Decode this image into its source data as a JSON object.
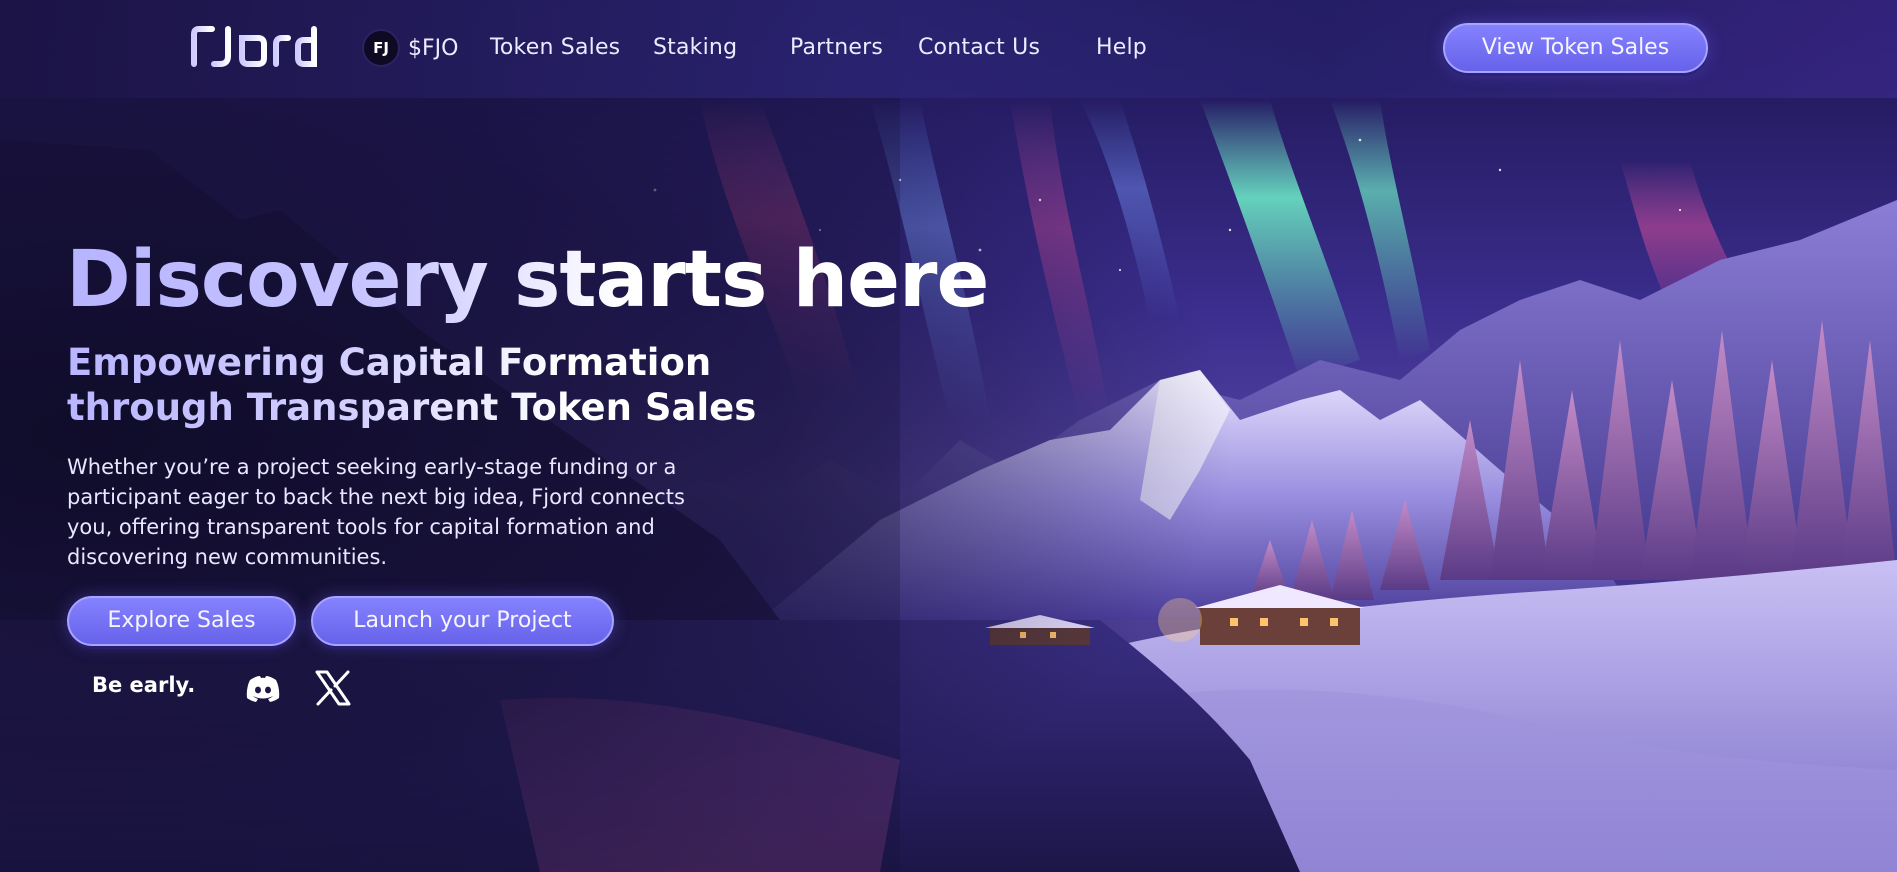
{
  "header": {
    "logo_text": "Fjord",
    "token": {
      "symbol": "FJ",
      "label": "$FJO"
    },
    "nav": [
      {
        "label": "Token Sales"
      },
      {
        "label": "Staking"
      },
      {
        "label": "Partners"
      },
      {
        "label": "Contact Us"
      },
      {
        "label": "Help"
      }
    ],
    "cta_label": "View Token Sales"
  },
  "hero": {
    "title": "Discovery starts here",
    "subtitle": "Empowering Capital Formation through Transparent Token Sales",
    "body": "Whether you’re a project seeking early-stage funding or a participant eager to back the next big idea, Fjord connects you, offering transparent tools for capital formation and discovering new communities.",
    "primary_button": "Explore Sales",
    "secondary_button": "Launch your Project",
    "tagline": "Be early.",
    "social_icons": [
      "discord-icon",
      "x-icon"
    ]
  },
  "colors": {
    "accent": "#6d68f2",
    "accent_border": "#a6a4ff",
    "header_bg": "#2a2470",
    "title_gradient_start": "#b7b4ff"
  }
}
